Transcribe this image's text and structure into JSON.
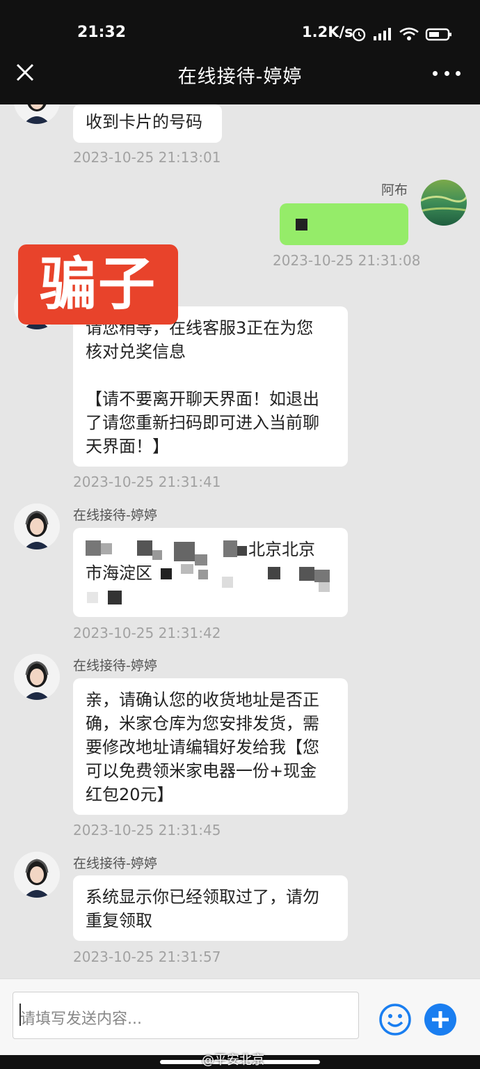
{
  "status_bar": {
    "time": "21:32",
    "net_rate": "1.2K/s"
  },
  "nav": {
    "title": "在线接待-婷婷"
  },
  "messages": {
    "m1": {
      "text": "收到卡片的号码",
      "ts": "2023-10-25 21:13:01"
    },
    "m2": {
      "sender": "阿布",
      "ts": "2023-10-25 21:31:08"
    },
    "m3": {
      "text": "请您稍等，在线客服3正在为您\n核对兑奖信息\n\n【请不要离开聊天界面！如退出\n了请您重新扫码即可进入当前聊\n天界面！】",
      "ts": "2023-10-25 21:31:41"
    },
    "m4": {
      "sender": "在线接待-婷婷",
      "visible_text_1": "北京北京",
      "visible_text_2": "市海淀区",
      "ts": "2023-10-25 21:31:42"
    },
    "m5": {
      "sender": "在线接待-婷婷",
      "text": "亲，请确认您的收货地址是否正\n确，米家仓库为您安排发货，需\n要修改地址请编辑好发给我【您\n可以免费领米家电器一份+现金\n红包20元】",
      "ts": "2023-10-25 21:31:45"
    },
    "m6": {
      "sender": "在线接待-婷婷",
      "text": "系统显示你已经领取过了，请勿\n重复领取",
      "ts": "2023-10-25 21:31:57"
    }
  },
  "overlay": {
    "label": "骗子"
  },
  "input": {
    "placeholder": "请填写发送内容..."
  },
  "watermark": "@平安北京",
  "colors": {
    "accent_green": "#95ec69",
    "scam_red": "#e8432b",
    "send_blue": "#1a7ef0"
  }
}
